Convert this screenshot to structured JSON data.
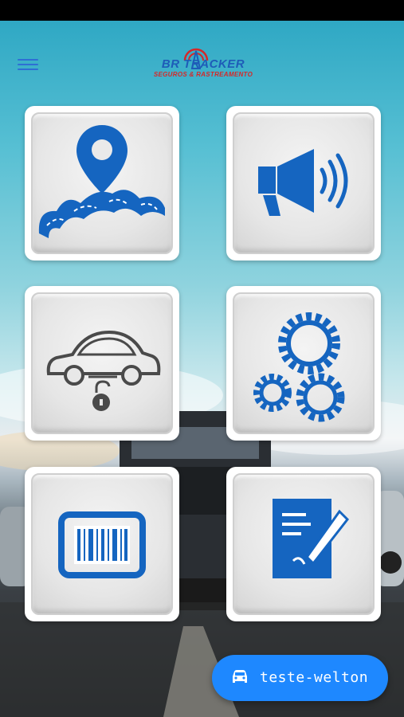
{
  "header": {
    "logo_main": "BR  TRACKER",
    "logo_sub": "SEGUROS & RASTREAMENTO",
    "menu_icon": "hamburger-menu-icon"
  },
  "tiles": [
    {
      "id": "route",
      "icon": "map-pin-road-icon"
    },
    {
      "id": "alert",
      "icon": "megaphone-icon"
    },
    {
      "id": "lock",
      "icon": "car-lock-icon"
    },
    {
      "id": "settings",
      "icon": "gears-icon"
    },
    {
      "id": "barcode",
      "icon": "barcode-icon"
    },
    {
      "id": "contract",
      "icon": "document-sign-icon"
    }
  ],
  "vehicle": {
    "label": "teste-welton",
    "icon": "car-icon"
  },
  "colors": {
    "accent": "#1e88ff",
    "icon_blue": "#1565c0",
    "icon_gray": "#4a4a4a",
    "logo_blue": "#1e5cb8",
    "logo_red": "#d62828"
  }
}
